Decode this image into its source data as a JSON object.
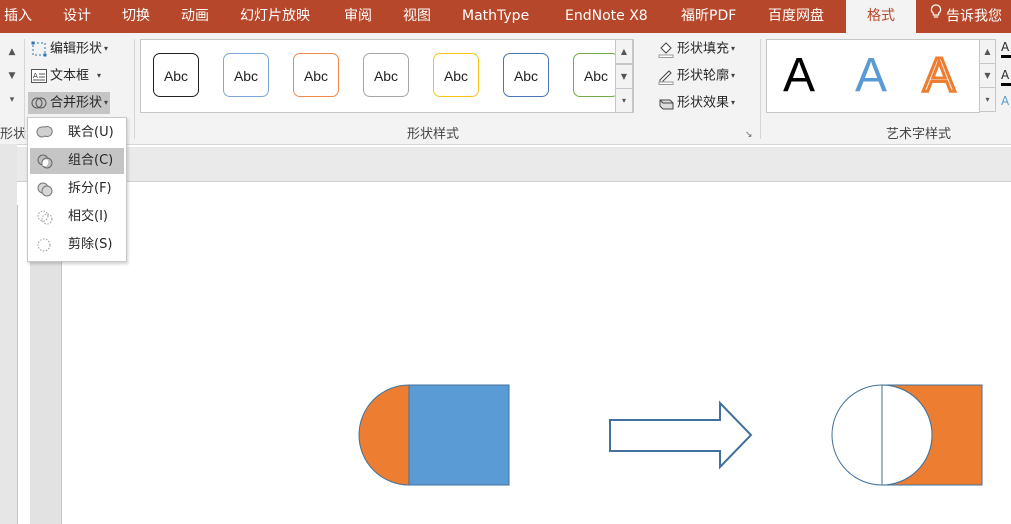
{
  "tabs": [
    "插入",
    "设计",
    "切换",
    "动画",
    "幻灯片放映",
    "审阅",
    "视图",
    "MathType",
    "EndNote X8",
    "福昕PDF",
    "百度网盘",
    "格式"
  ],
  "active_tab": "格式",
  "tell_me": "告诉我您",
  "insert_shapes": {
    "edit_shape": "编辑形状",
    "text_box": "文本框",
    "merge_shapes": "合并形状",
    "group_label_partial": "形状"
  },
  "merge_menu": {
    "items": [
      {
        "label": "联合(U)",
        "icon": "union-icon"
      },
      {
        "label": "组合(C)",
        "icon": "combine-icon"
      },
      {
        "label": "拆分(F)",
        "icon": "fragment-icon"
      },
      {
        "label": "相交(I)",
        "icon": "intersect-icon"
      },
      {
        "label": "剪除(S)",
        "icon": "subtract-icon"
      }
    ],
    "selected_index": 1
  },
  "shape_styles": {
    "gallery_sample_text": "Abc",
    "swatch_colors": [
      "#222222",
      "#7da7d9",
      "#ee8a4a",
      "#a6a6a6",
      "#f5c518",
      "#4a74b4",
      "#70ad47"
    ],
    "fill": "形状填充",
    "outline": "形状轮廓",
    "effects": "形状效果",
    "group_label": "形状样式"
  },
  "wordart": {
    "sample": "A",
    "colors": [
      "#000000",
      "#5b9bd5",
      "#ed7d31"
    ],
    "group_label": "艺术字样式"
  },
  "colors": {
    "tab_bar": "#b7472a",
    "shape_orange": "#ed7d31",
    "shape_blue": "#5b9bd5",
    "arrow_outline": "#41719c"
  }
}
